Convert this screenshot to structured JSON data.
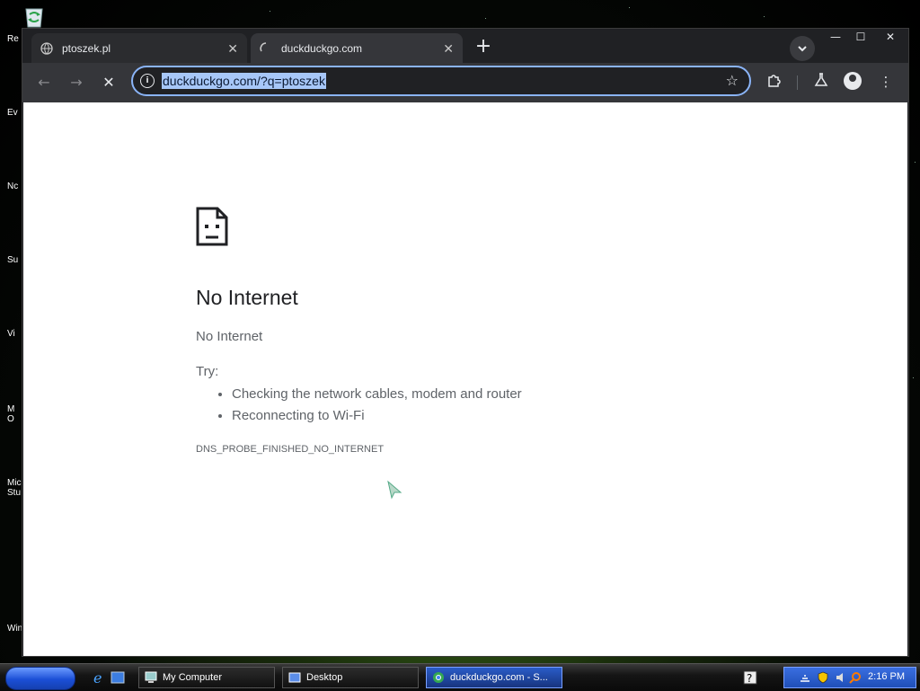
{
  "desktop": {
    "labels": [
      "Re",
      "Ev",
      "Nc",
      "Su",
      "Vi",
      "M\nO",
      "Micro\nStu",
      "Wind"
    ]
  },
  "browser": {
    "tabs": [
      {
        "title": "ptoszek.pl",
        "active": false
      },
      {
        "title": "duckduckgo.com",
        "active": true
      }
    ],
    "new_tab_label": "+",
    "window_controls": {
      "minimize": "—",
      "maximize": "☐",
      "close": "✕"
    },
    "omnibox": {
      "url": "duckduckgo.com/?q=ptoszek",
      "selected": true
    }
  },
  "error_page": {
    "title": "No Internet",
    "subtitle": "No Internet",
    "try_label": "Try:",
    "suggestions": [
      "Checking the network cables, modem and router",
      "Reconnecting to Wi-Fi"
    ],
    "error_code": "DNS_PROBE_FINISHED_NO_INTERNET"
  },
  "taskbar": {
    "tasks": [
      {
        "label": "My Computer",
        "active": false
      },
      {
        "label": "Desktop",
        "active": false
      },
      {
        "label": "duckduckgo.com - S...",
        "active": true
      }
    ],
    "clock": "2:16 PM"
  },
  "colors": {
    "omnibox_focus": "#8ab4f8",
    "selection": "#a7c7f8",
    "taskbar_active": "#2a5cc8"
  }
}
